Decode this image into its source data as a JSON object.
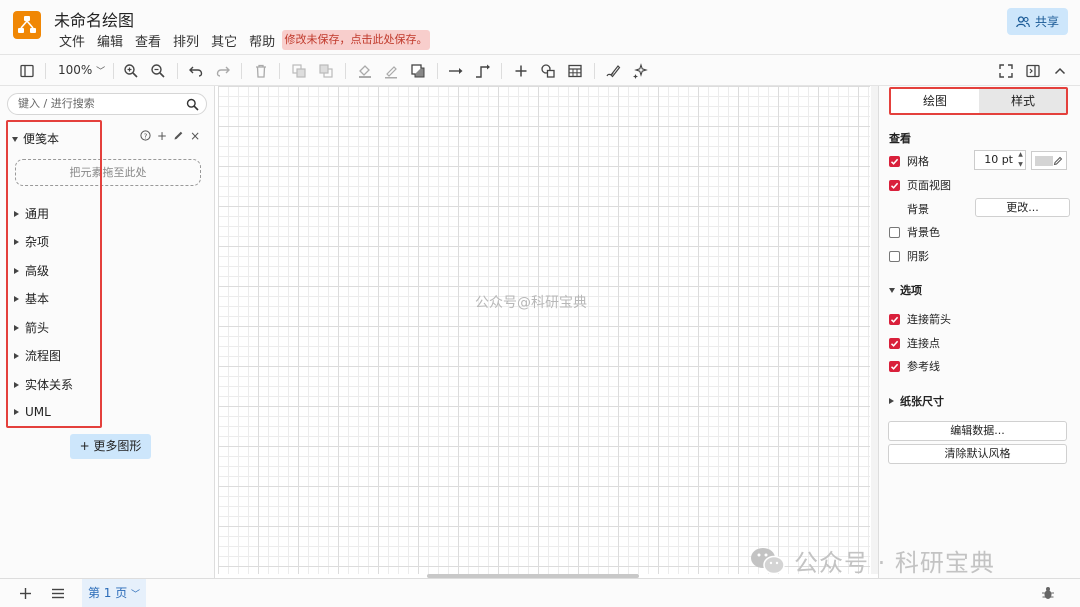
{
  "header": {
    "doc_title": "未命名绘图",
    "menu": [
      "文件",
      "编辑",
      "查看",
      "排列",
      "其它",
      "帮助"
    ],
    "unsaved_notice": "修改未保存，点击此处保存。",
    "share_label": "共享"
  },
  "toolbar": {
    "zoom": "100%"
  },
  "left_panel": {
    "search_placeholder": "键入 / 进行搜索",
    "scratchpad_title": "便笺本",
    "drop_hint": "把元素拖至此处",
    "libraries": [
      "通用",
      "杂项",
      "高级",
      "基本",
      "箭头",
      "流程图",
      "实体关系",
      "UML"
    ],
    "more_shapes": "+ 更多图形"
  },
  "canvas": {
    "watermark": "公众号@科研宝典"
  },
  "right_panel": {
    "tabs": [
      "绘图",
      "样式"
    ],
    "view_section": "查看",
    "grid_label": "网格",
    "grid_size": "10 pt",
    "page_view_label": "页面视图",
    "background_label": "背景",
    "change_button": "更改...",
    "bg_color_label": "背景色",
    "shadow_label": "阴影",
    "options_section": "选项",
    "connect_arrows": "连接箭头",
    "connect_points": "连接点",
    "guides": "参考线",
    "paper_size_section": "纸张尺寸",
    "edit_data_button": "编辑数据...",
    "clear_style_button": "清除默认风格"
  },
  "bottom_bar": {
    "page_tab": "第 1 页"
  },
  "overlay": {
    "watermark_text": "公众号 · 科研宝典"
  },
  "colors": {
    "accent_checkbox": "#d9203b",
    "highlight_frame": "#e4403c",
    "logo": "#f08705",
    "share_bg": "#cde6fb"
  }
}
